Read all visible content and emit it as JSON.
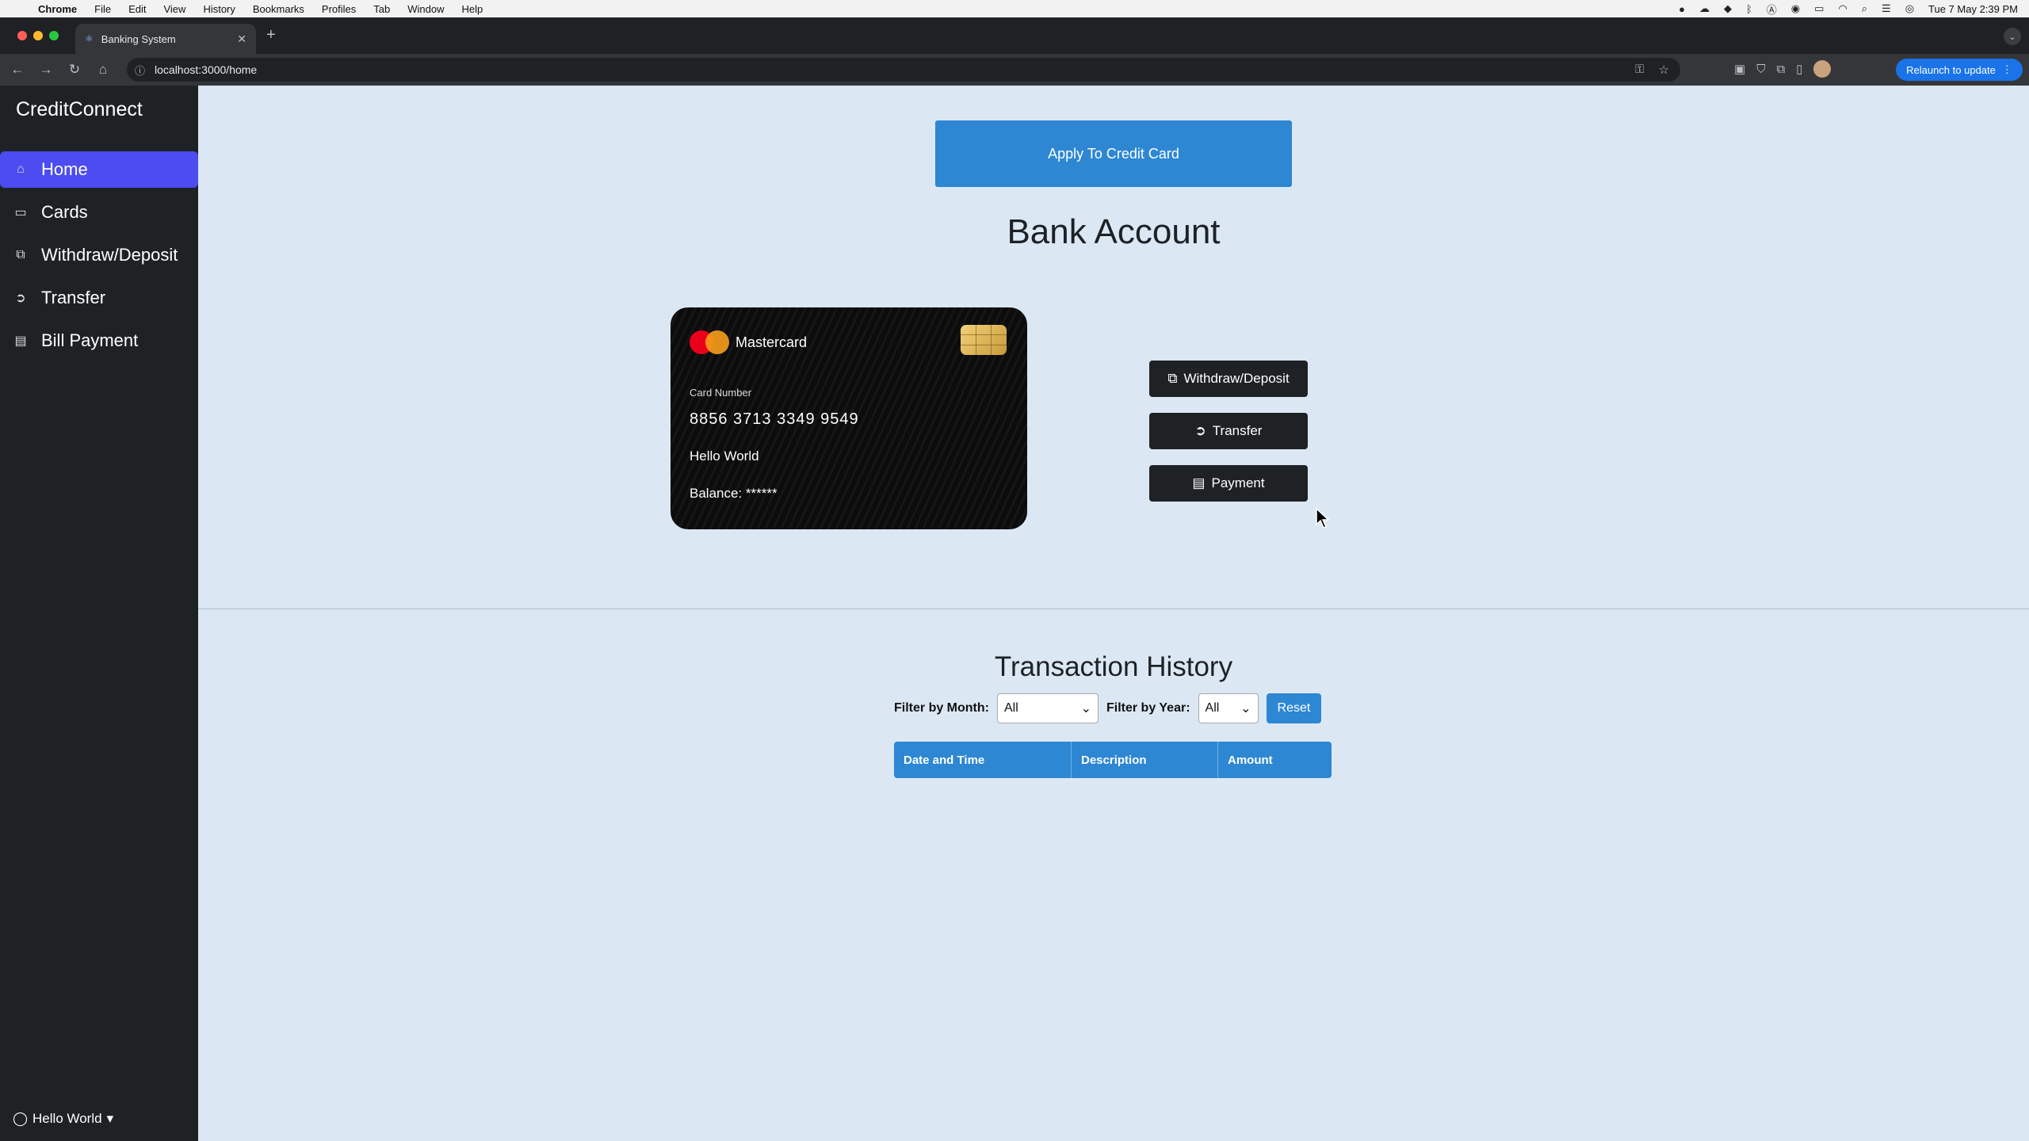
{
  "menubar": {
    "app": "Chrome",
    "items": [
      "File",
      "Edit",
      "View",
      "History",
      "Bookmarks",
      "Profiles",
      "Tab",
      "Window",
      "Help"
    ],
    "clock": "Tue 7 May  2:39 PM"
  },
  "browser": {
    "tab_title": "Banking System",
    "url": "localhost:3000/home",
    "relaunch_label": "Relaunch to update"
  },
  "sidebar": {
    "brand": "CreditConnect",
    "items": [
      {
        "label": "Home",
        "icon": "home-icon",
        "active": true
      },
      {
        "label": "Cards",
        "icon": "card-icon"
      },
      {
        "label": "Withdraw/Deposit",
        "icon": "cash-icon"
      },
      {
        "label": "Transfer",
        "icon": "arrow-circle-icon"
      },
      {
        "label": "Bill Payment",
        "icon": "receipt-icon"
      }
    ],
    "user": "Hello World"
  },
  "main": {
    "apply_button": "Apply To Credit Card",
    "bank_title": "Bank Account",
    "card": {
      "brand": "Mastercard",
      "number_label": "Card Number",
      "number": "8856 3713 3349 9549",
      "holder": "Hello World",
      "balance": "Balance: ******"
    },
    "actions": {
      "withdraw_deposit": "Withdraw/Deposit",
      "transfer": "Transfer",
      "payment": "Payment"
    },
    "transactions": {
      "title": "Transaction History",
      "month_label": "Filter by Month:",
      "month_value": "All",
      "year_label": "Filter by Year:",
      "year_value": "All",
      "reset": "Reset",
      "columns": [
        "Date and Time",
        "Description",
        "Amount"
      ]
    }
  },
  "colors": {
    "sidebar_bg": "#1f2225",
    "active_nav": "#4c4cf0",
    "primary_blue": "#2d87d3",
    "page_bg": "#dbe8f3"
  }
}
